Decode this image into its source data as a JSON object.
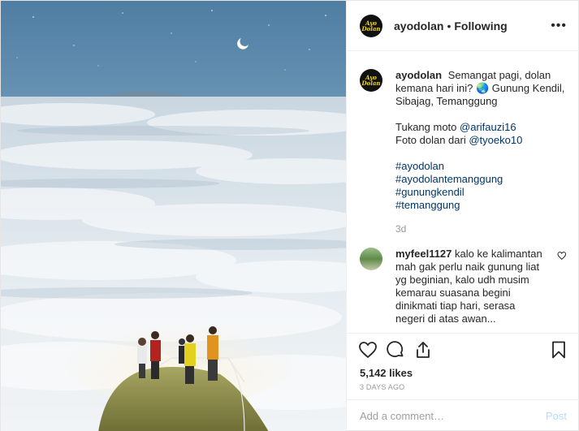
{
  "post": {
    "username": "ayodolan",
    "separator": "•",
    "follow_status": "Following",
    "avatar_logo_line1": "Ayo",
    "avatar_logo_line2": "Dolan",
    "more_label": "•••"
  },
  "caption": {
    "username": "ayodolan",
    "line1": "Semangat pagi, dolan",
    "line2": "kemana hari ini? 🌏 Gunung Kendil,",
    "line3": "Sibajag, Temanggung",
    "credit1_prefix": "Tukang moto ",
    "credit1_handle": "@arifauzi16",
    "credit2_prefix": "Foto dolan dari ",
    "credit2_handle": "@tyoeko10",
    "hashtags": [
      "#ayodolan",
      "#ayodolantemanggung",
      "#gunungkendil",
      "#temanggung"
    ],
    "age": "3d"
  },
  "comment": {
    "username": "myfeel1127",
    "text_line1": "kalo ke kalimantan",
    "text_line2": "mah gak perlu naik gunung liat",
    "text_line3": "yg beginian, kalo udh musim",
    "text_line4": "kemarau suasana begini",
    "text_line5": "dinikmati tiap hari, serasa",
    "text_line6": "negeri di atas awan..."
  },
  "stats": {
    "likes": "5,142 likes",
    "date": "3 DAYS AGO"
  },
  "add_comment": {
    "placeholder": "Add a comment…",
    "post_label": "Post"
  },
  "icons": {
    "like": "heart-icon",
    "comment": "comment-bubble-icon",
    "share": "share-icon",
    "save": "bookmark-icon"
  }
}
